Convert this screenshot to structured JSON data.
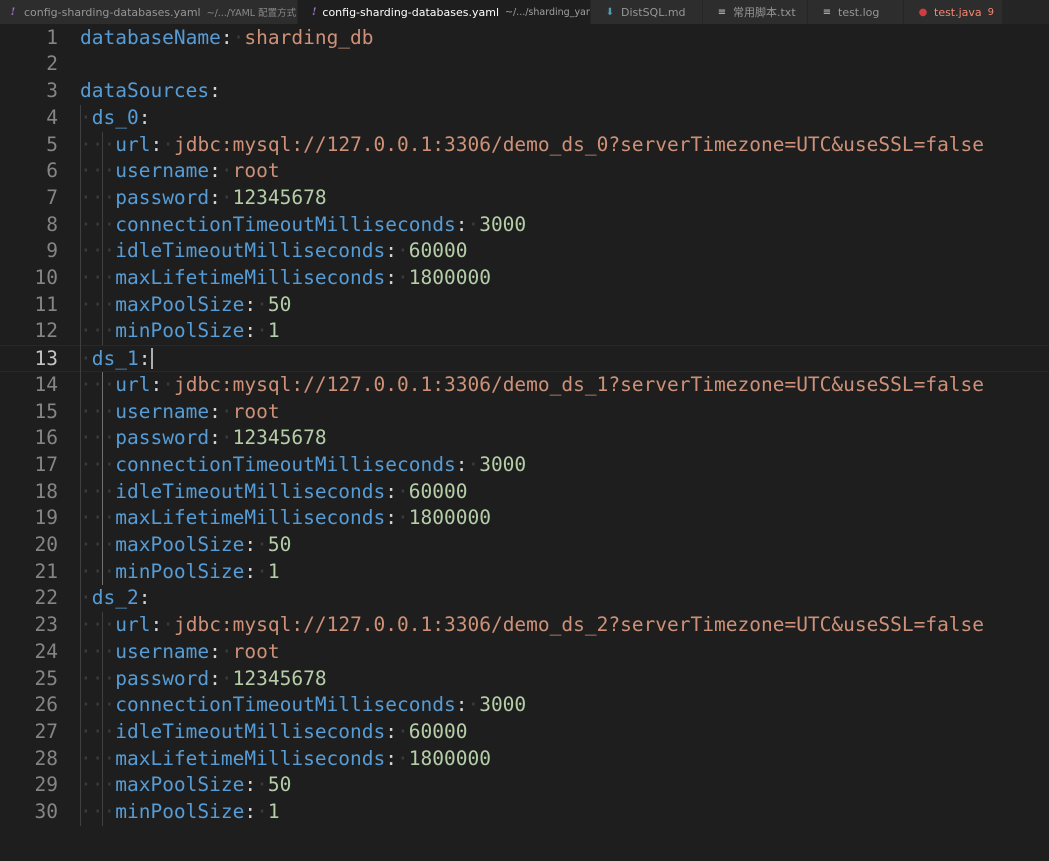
{
  "tabs": [
    {
      "icon": "!",
      "icon_kind": "yaml",
      "name": "config-sharding-databases.yaml",
      "desc": "~/.../YAML 配置方式",
      "active": false
    },
    {
      "icon": "!",
      "icon_kind": "yaml",
      "name": "config-sharding-databases.yaml",
      "desc": "~/.../sharding_yaml",
      "active": true,
      "close": "×"
    },
    {
      "icon": "⬇",
      "icon_kind": "md",
      "name": "DistSQL.md",
      "desc": "",
      "active": false
    },
    {
      "icon": "≡",
      "icon_kind": "txt",
      "name": "常用脚本.txt",
      "desc": "",
      "active": false
    },
    {
      "icon": "≡",
      "icon_kind": "log",
      "name": "test.log",
      "desc": "",
      "active": false
    },
    {
      "icon": "●",
      "icon_kind": "java",
      "name": "test.java",
      "desc": "",
      "active": false,
      "errors": "9"
    }
  ],
  "editor": {
    "current_line": 13,
    "lines": [
      {
        "n": "1",
        "indent": 0,
        "tokens": [
          [
            "k",
            "databaseName"
          ],
          [
            "p",
            ":"
          ],
          [
            "ws",
            "·"
          ],
          [
            "s",
            "sharding_db"
          ]
        ]
      },
      {
        "n": "2",
        "indent": 0,
        "tokens": []
      },
      {
        "n": "3",
        "indent": 0,
        "tokens": [
          [
            "k",
            "dataSources"
          ],
          [
            "p",
            ":"
          ]
        ]
      },
      {
        "n": "4",
        "indent": 1,
        "tokens": [
          [
            "k",
            "ds_0"
          ],
          [
            "p",
            ":"
          ]
        ]
      },
      {
        "n": "5",
        "indent": 2,
        "tokens": [
          [
            "k",
            "url"
          ],
          [
            "p",
            ":"
          ],
          [
            "ws",
            "·"
          ],
          [
            "s",
            "jdbc:mysql://127.0.0.1:3306/demo_ds_0?serverTimezone=UTC&useSSL=false"
          ]
        ]
      },
      {
        "n": "6",
        "indent": 2,
        "tokens": [
          [
            "k",
            "username"
          ],
          [
            "p",
            ":"
          ],
          [
            "ws",
            "·"
          ],
          [
            "s",
            "root"
          ]
        ]
      },
      {
        "n": "7",
        "indent": 2,
        "tokens": [
          [
            "k",
            "password"
          ],
          [
            "p",
            ":"
          ],
          [
            "ws",
            "·"
          ],
          [
            "n",
            "12345678"
          ]
        ]
      },
      {
        "n": "8",
        "indent": 2,
        "tokens": [
          [
            "k",
            "connectionTimeoutMilliseconds"
          ],
          [
            "p",
            ":"
          ],
          [
            "ws",
            "·"
          ],
          [
            "n",
            "3000"
          ]
        ]
      },
      {
        "n": "9",
        "indent": 2,
        "tokens": [
          [
            "k",
            "idleTimeoutMilliseconds"
          ],
          [
            "p",
            ":"
          ],
          [
            "ws",
            "·"
          ],
          [
            "n",
            "60000"
          ]
        ]
      },
      {
        "n": "10",
        "indent": 2,
        "tokens": [
          [
            "k",
            "maxLifetimeMilliseconds"
          ],
          [
            "p",
            ":"
          ],
          [
            "ws",
            "·"
          ],
          [
            "n",
            "1800000"
          ]
        ]
      },
      {
        "n": "11",
        "indent": 2,
        "tokens": [
          [
            "k",
            "maxPoolSize"
          ],
          [
            "p",
            ":"
          ],
          [
            "ws",
            "·"
          ],
          [
            "n",
            "50"
          ]
        ]
      },
      {
        "n": "12",
        "indent": 2,
        "tokens": [
          [
            "k",
            "minPoolSize"
          ],
          [
            "p",
            ":"
          ],
          [
            "ws",
            "·"
          ],
          [
            "n",
            "1"
          ]
        ]
      },
      {
        "n": "13",
        "indent": 1,
        "tokens": [
          [
            "k",
            "ds_1"
          ],
          [
            "p",
            ":"
          ]
        ]
      },
      {
        "n": "14",
        "indent": 2,
        "tokens": [
          [
            "k",
            "url"
          ],
          [
            "p",
            ":"
          ],
          [
            "ws",
            "·"
          ],
          [
            "s",
            "jdbc:mysql://127.0.0.1:3306/demo_ds_1?serverTimezone=UTC&useSSL=false"
          ]
        ]
      },
      {
        "n": "15",
        "indent": 2,
        "tokens": [
          [
            "k",
            "username"
          ],
          [
            "p",
            ":"
          ],
          [
            "ws",
            "·"
          ],
          [
            "s",
            "root"
          ]
        ]
      },
      {
        "n": "16",
        "indent": 2,
        "tokens": [
          [
            "k",
            "password"
          ],
          [
            "p",
            ":"
          ],
          [
            "ws",
            "·"
          ],
          [
            "n",
            "12345678"
          ]
        ]
      },
      {
        "n": "17",
        "indent": 2,
        "tokens": [
          [
            "k",
            "connectionTimeoutMilliseconds"
          ],
          [
            "p",
            ":"
          ],
          [
            "ws",
            "·"
          ],
          [
            "n",
            "3000"
          ]
        ]
      },
      {
        "n": "18",
        "indent": 2,
        "tokens": [
          [
            "k",
            "idleTimeoutMilliseconds"
          ],
          [
            "p",
            ":"
          ],
          [
            "ws",
            "·"
          ],
          [
            "n",
            "60000"
          ]
        ]
      },
      {
        "n": "19",
        "indent": 2,
        "tokens": [
          [
            "k",
            "maxLifetimeMilliseconds"
          ],
          [
            "p",
            ":"
          ],
          [
            "ws",
            "·"
          ],
          [
            "n",
            "1800000"
          ]
        ]
      },
      {
        "n": "20",
        "indent": 2,
        "tokens": [
          [
            "k",
            "maxPoolSize"
          ],
          [
            "p",
            ":"
          ],
          [
            "ws",
            "·"
          ],
          [
            "n",
            "50"
          ]
        ]
      },
      {
        "n": "21",
        "indent": 2,
        "tokens": [
          [
            "k",
            "minPoolSize"
          ],
          [
            "p",
            ":"
          ],
          [
            "ws",
            "·"
          ],
          [
            "n",
            "1"
          ]
        ]
      },
      {
        "n": "22",
        "indent": 1,
        "tokens": [
          [
            "k",
            "ds_2"
          ],
          [
            "p",
            ":"
          ]
        ]
      },
      {
        "n": "23",
        "indent": 2,
        "tokens": [
          [
            "k",
            "url"
          ],
          [
            "p",
            ":"
          ],
          [
            "ws",
            "·"
          ],
          [
            "s",
            "jdbc:mysql://127.0.0.1:3306/demo_ds_2?serverTimezone=UTC&useSSL=false"
          ]
        ]
      },
      {
        "n": "24",
        "indent": 2,
        "tokens": [
          [
            "k",
            "username"
          ],
          [
            "p",
            ":"
          ],
          [
            "ws",
            "·"
          ],
          [
            "s",
            "root"
          ]
        ]
      },
      {
        "n": "25",
        "indent": 2,
        "tokens": [
          [
            "k",
            "password"
          ],
          [
            "p",
            ":"
          ],
          [
            "ws",
            "·"
          ],
          [
            "n",
            "12345678"
          ]
        ]
      },
      {
        "n": "26",
        "indent": 2,
        "tokens": [
          [
            "k",
            "connectionTimeoutMilliseconds"
          ],
          [
            "p",
            ":"
          ],
          [
            "ws",
            "·"
          ],
          [
            "n",
            "3000"
          ]
        ]
      },
      {
        "n": "27",
        "indent": 2,
        "tokens": [
          [
            "k",
            "idleTimeoutMilliseconds"
          ],
          [
            "p",
            ":"
          ],
          [
            "ws",
            "·"
          ],
          [
            "n",
            "60000"
          ]
        ]
      },
      {
        "n": "28",
        "indent": 2,
        "tokens": [
          [
            "k",
            "maxLifetimeMilliseconds"
          ],
          [
            "p",
            ":"
          ],
          [
            "ws",
            "·"
          ],
          [
            "n",
            "1800000"
          ]
        ]
      },
      {
        "n": "29",
        "indent": 2,
        "tokens": [
          [
            "k",
            "maxPoolSize"
          ],
          [
            "p",
            ":"
          ],
          [
            "ws",
            "·"
          ],
          [
            "n",
            "50"
          ]
        ]
      },
      {
        "n": "30",
        "indent": 2,
        "tokens": [
          [
            "k",
            "minPoolSize"
          ],
          [
            "p",
            ":"
          ],
          [
            "ws",
            "·"
          ],
          [
            "n",
            "1"
          ]
        ]
      }
    ]
  },
  "colors": {
    "key": "#569cd6",
    "string": "#ce9178",
    "number": "#b5cea8",
    "punctuation": "#d4d4d4",
    "background": "#1e1e1e"
  }
}
